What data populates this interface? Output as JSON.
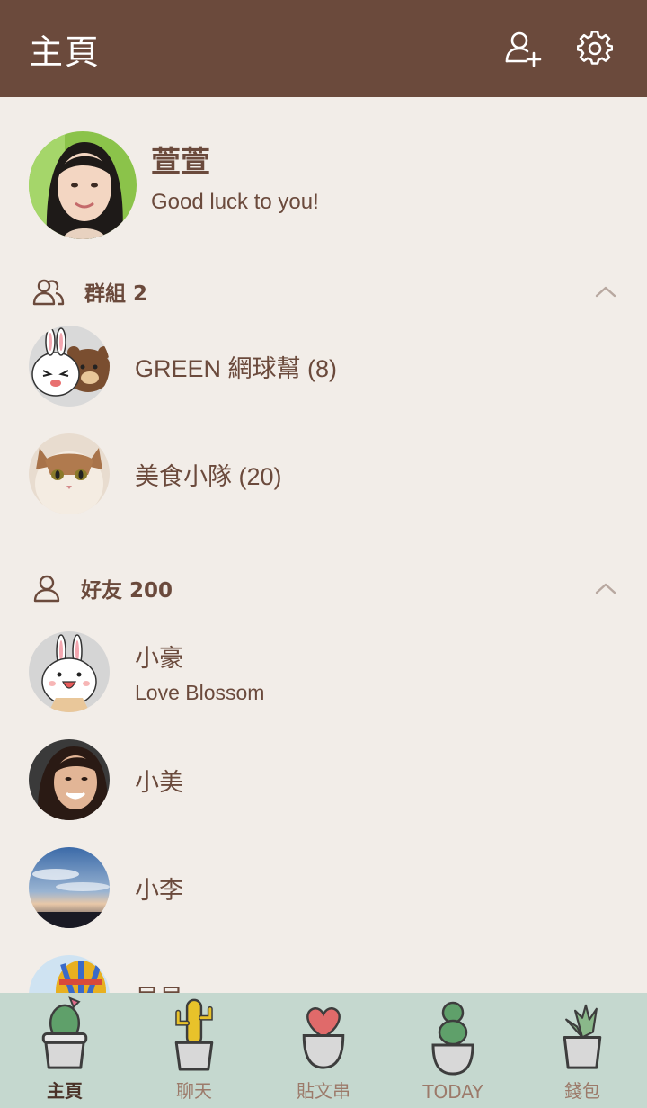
{
  "header": {
    "title": "主頁",
    "add_friend_icon": "add-friend-icon",
    "settings_icon": "gear-icon"
  },
  "profile": {
    "name": "萱萱",
    "status": "Good luck to you!"
  },
  "groups": {
    "label": "群組 2",
    "items": [
      {
        "name": "GREEN 網球幫 (8)"
      },
      {
        "name": "美食小隊 (20)"
      }
    ]
  },
  "friends": {
    "label": "好友 200",
    "items": [
      {
        "name": "小豪",
        "status": "Love Blossom"
      },
      {
        "name": "小美"
      },
      {
        "name": "小李"
      },
      {
        "name": "貝貝"
      }
    ]
  },
  "tabs": [
    {
      "label": "主頁",
      "active": true
    },
    {
      "label": "聊天"
    },
    {
      "label": "貼文串"
    },
    {
      "label": "TODAY"
    },
    {
      "label": "錢包"
    }
  ],
  "colors": {
    "header_bg": "#6b4a3c",
    "page_bg": "#f2ede8",
    "text": "#6b4a3c",
    "nav_bg": "#c5d8cf"
  }
}
